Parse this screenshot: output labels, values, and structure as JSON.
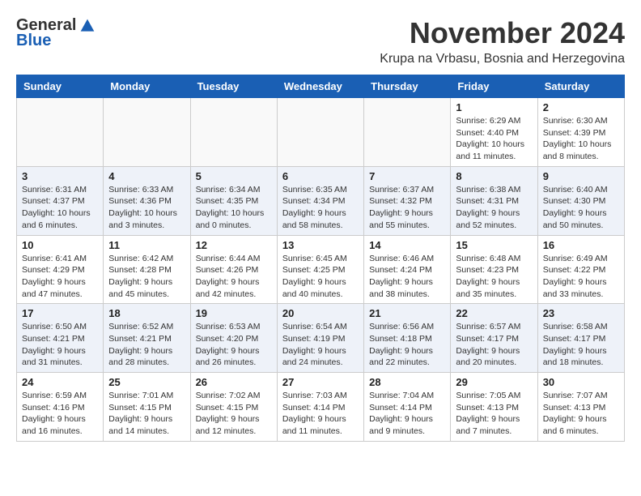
{
  "logo": {
    "general": "General",
    "blue": "Blue"
  },
  "title": "November 2024",
  "location": "Krupa na Vrbasu, Bosnia and Herzegovina",
  "headers": [
    "Sunday",
    "Monday",
    "Tuesday",
    "Wednesday",
    "Thursday",
    "Friday",
    "Saturday"
  ],
  "weeks": [
    [
      {
        "day": "",
        "info": ""
      },
      {
        "day": "",
        "info": ""
      },
      {
        "day": "",
        "info": ""
      },
      {
        "day": "",
        "info": ""
      },
      {
        "day": "",
        "info": ""
      },
      {
        "day": "1",
        "info": "Sunrise: 6:29 AM\nSunset: 4:40 PM\nDaylight: 10 hours and 11 minutes."
      },
      {
        "day": "2",
        "info": "Sunrise: 6:30 AM\nSunset: 4:39 PM\nDaylight: 10 hours and 8 minutes."
      }
    ],
    [
      {
        "day": "3",
        "info": "Sunrise: 6:31 AM\nSunset: 4:37 PM\nDaylight: 10 hours and 6 minutes."
      },
      {
        "day": "4",
        "info": "Sunrise: 6:33 AM\nSunset: 4:36 PM\nDaylight: 10 hours and 3 minutes."
      },
      {
        "day": "5",
        "info": "Sunrise: 6:34 AM\nSunset: 4:35 PM\nDaylight: 10 hours and 0 minutes."
      },
      {
        "day": "6",
        "info": "Sunrise: 6:35 AM\nSunset: 4:34 PM\nDaylight: 9 hours and 58 minutes."
      },
      {
        "day": "7",
        "info": "Sunrise: 6:37 AM\nSunset: 4:32 PM\nDaylight: 9 hours and 55 minutes."
      },
      {
        "day": "8",
        "info": "Sunrise: 6:38 AM\nSunset: 4:31 PM\nDaylight: 9 hours and 52 minutes."
      },
      {
        "day": "9",
        "info": "Sunrise: 6:40 AM\nSunset: 4:30 PM\nDaylight: 9 hours and 50 minutes."
      }
    ],
    [
      {
        "day": "10",
        "info": "Sunrise: 6:41 AM\nSunset: 4:29 PM\nDaylight: 9 hours and 47 minutes."
      },
      {
        "day": "11",
        "info": "Sunrise: 6:42 AM\nSunset: 4:28 PM\nDaylight: 9 hours and 45 minutes."
      },
      {
        "day": "12",
        "info": "Sunrise: 6:44 AM\nSunset: 4:26 PM\nDaylight: 9 hours and 42 minutes."
      },
      {
        "day": "13",
        "info": "Sunrise: 6:45 AM\nSunset: 4:25 PM\nDaylight: 9 hours and 40 minutes."
      },
      {
        "day": "14",
        "info": "Sunrise: 6:46 AM\nSunset: 4:24 PM\nDaylight: 9 hours and 38 minutes."
      },
      {
        "day": "15",
        "info": "Sunrise: 6:48 AM\nSunset: 4:23 PM\nDaylight: 9 hours and 35 minutes."
      },
      {
        "day": "16",
        "info": "Sunrise: 6:49 AM\nSunset: 4:22 PM\nDaylight: 9 hours and 33 minutes."
      }
    ],
    [
      {
        "day": "17",
        "info": "Sunrise: 6:50 AM\nSunset: 4:21 PM\nDaylight: 9 hours and 31 minutes."
      },
      {
        "day": "18",
        "info": "Sunrise: 6:52 AM\nSunset: 4:21 PM\nDaylight: 9 hours and 28 minutes."
      },
      {
        "day": "19",
        "info": "Sunrise: 6:53 AM\nSunset: 4:20 PM\nDaylight: 9 hours and 26 minutes."
      },
      {
        "day": "20",
        "info": "Sunrise: 6:54 AM\nSunset: 4:19 PM\nDaylight: 9 hours and 24 minutes."
      },
      {
        "day": "21",
        "info": "Sunrise: 6:56 AM\nSunset: 4:18 PM\nDaylight: 9 hours and 22 minutes."
      },
      {
        "day": "22",
        "info": "Sunrise: 6:57 AM\nSunset: 4:17 PM\nDaylight: 9 hours and 20 minutes."
      },
      {
        "day": "23",
        "info": "Sunrise: 6:58 AM\nSunset: 4:17 PM\nDaylight: 9 hours and 18 minutes."
      }
    ],
    [
      {
        "day": "24",
        "info": "Sunrise: 6:59 AM\nSunset: 4:16 PM\nDaylight: 9 hours and 16 minutes."
      },
      {
        "day": "25",
        "info": "Sunrise: 7:01 AM\nSunset: 4:15 PM\nDaylight: 9 hours and 14 minutes."
      },
      {
        "day": "26",
        "info": "Sunrise: 7:02 AM\nSunset: 4:15 PM\nDaylight: 9 hours and 12 minutes."
      },
      {
        "day": "27",
        "info": "Sunrise: 7:03 AM\nSunset: 4:14 PM\nDaylight: 9 hours and 11 minutes."
      },
      {
        "day": "28",
        "info": "Sunrise: 7:04 AM\nSunset: 4:14 PM\nDaylight: 9 hours and 9 minutes."
      },
      {
        "day": "29",
        "info": "Sunrise: 7:05 AM\nSunset: 4:13 PM\nDaylight: 9 hours and 7 minutes."
      },
      {
        "day": "30",
        "info": "Sunrise: 7:07 AM\nSunset: 4:13 PM\nDaylight: 9 hours and 6 minutes."
      }
    ]
  ]
}
